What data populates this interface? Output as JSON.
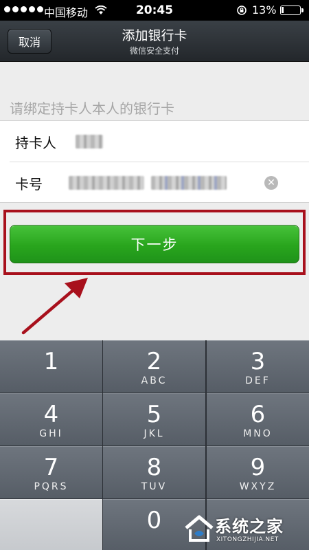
{
  "status_bar": {
    "carrier": "中国移动",
    "time": "20:45",
    "battery_percent": "13%",
    "battery_level": 0.13
  },
  "nav": {
    "cancel_label": "取消",
    "title": "添加银行卡",
    "subtitle": "微信安全支付"
  },
  "form": {
    "section_label": "请绑定持卡人本人的银行卡",
    "cardholder_label": "持卡人",
    "card_number_label": "卡号"
  },
  "next_button_label": "下一步",
  "keypad": {
    "keys": [
      {
        "num": "1",
        "letters": ""
      },
      {
        "num": "2",
        "letters": "ABC"
      },
      {
        "num": "3",
        "letters": "DEF"
      },
      {
        "num": "4",
        "letters": "GHI"
      },
      {
        "num": "5",
        "letters": "JKL"
      },
      {
        "num": "6",
        "letters": "MNO"
      },
      {
        "num": "7",
        "letters": "PQRS"
      },
      {
        "num": "8",
        "letters": "TUV"
      },
      {
        "num": "9",
        "letters": "WXYZ"
      },
      {
        "num": "0",
        "letters": ""
      }
    ]
  },
  "watermark": {
    "title": "系统之家",
    "url": "XITONGZHIJIA.NET"
  },
  "colors": {
    "button_green": "#29a51d",
    "highlight_red": "#a8101c",
    "nav_bg": "#2b3035"
  }
}
